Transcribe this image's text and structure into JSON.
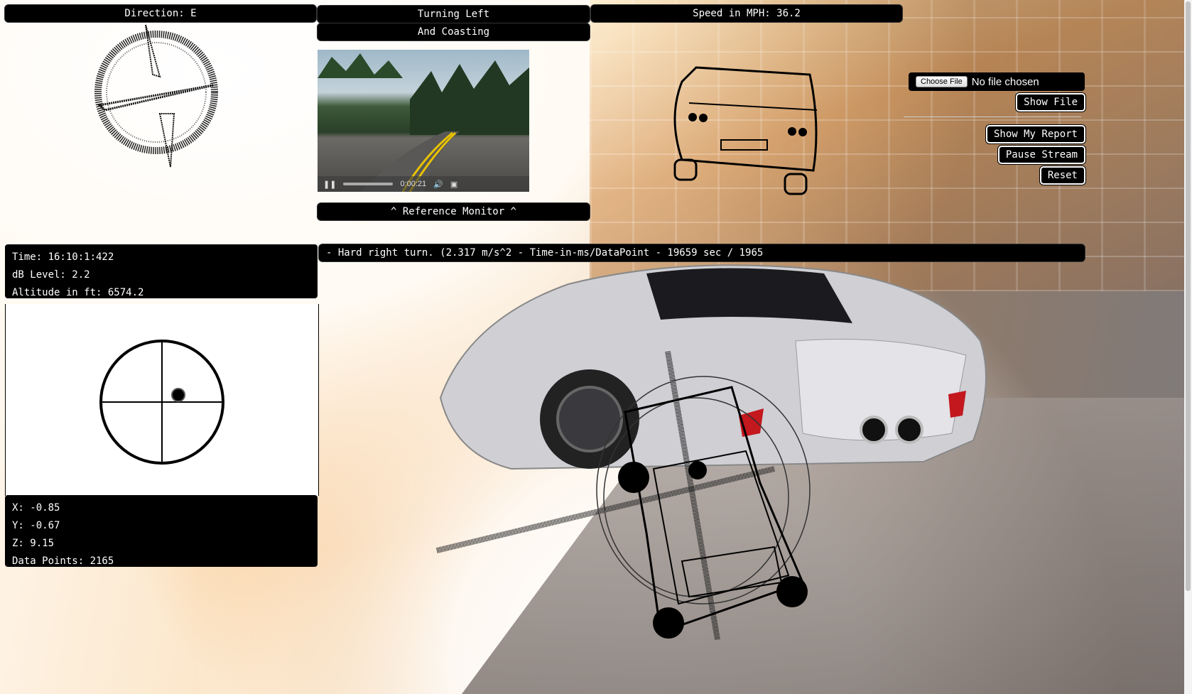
{
  "header": {
    "direction": "Direction: E",
    "turn_status_1": "Turning Left",
    "turn_status_2": "And Coasting",
    "speed": "Speed in MPH: 36.2"
  },
  "video": {
    "time": "0:00:21",
    "caption": "^ Reference Monitor ^"
  },
  "file": {
    "choose_label": "Choose File",
    "status": "No file chosen"
  },
  "buttons": {
    "show_file": "Show File",
    "show_report": "Show My Report",
    "pause_stream": "Pause Stream",
    "reset": "Reset"
  },
  "info": {
    "time": "Time: 16:10:1:422",
    "db": "dB Level: 2.2",
    "altitude": "Altitude in ft: 6574.2"
  },
  "accel": {
    "x": "X: -0.85",
    "y": "Y: -0.67",
    "z": "Z: 9.15",
    "points": "Data Points: 2165"
  },
  "event_bar": "- Hard right turn. (2.317 m/s^2 - Time-in-ms/DataPoint - 19659 sec / 1965",
  "colors": {
    "panel": "#000000",
    "text": "#ffffff"
  }
}
